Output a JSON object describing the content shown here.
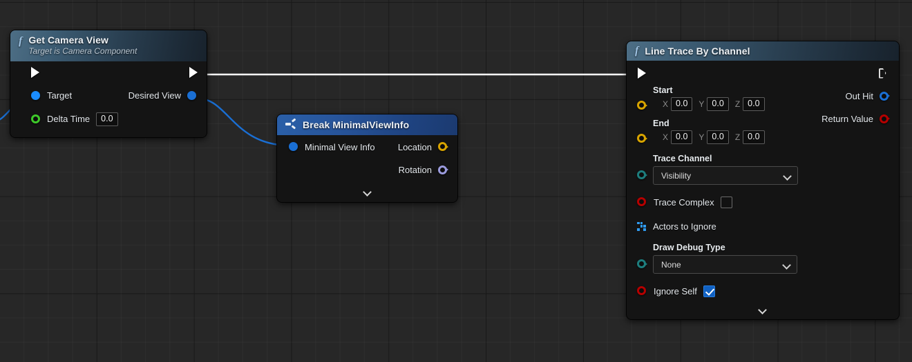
{
  "app": {
    "name": "Unreal Engine Blueprint Graph Editor",
    "canvas_background": "#272727",
    "grid_minor_color": "#333333",
    "grid_major_color": "#121212"
  },
  "wires": [
    {
      "name": "exec-wire-get-camera-view-to-line-trace",
      "type": "exec",
      "color": "#ffffff"
    },
    {
      "name": "data-wire-desired-view-to-minimal-view-info",
      "type": "struct",
      "color": "#1a6fd4"
    },
    {
      "name": "data-wire-incoming-target",
      "type": "object",
      "color": "#1a6fd4"
    }
  ],
  "nodes": {
    "get_camera_view": {
      "title": "Get Camera View",
      "subtitle": "Target is Camera Component",
      "icon": "function-f-icon",
      "header_color": "#3c5c73",
      "exec_in": "exec-in",
      "exec_out": "exec-out",
      "inputs": [
        {
          "label": "Target",
          "pin": "object-pin",
          "color": "#1a8cff",
          "style": "filled"
        },
        {
          "label": "Delta Time",
          "pin": "float-pin",
          "color": "#3ec92a",
          "style": "hollow",
          "value": "0.0"
        }
      ],
      "outputs": [
        {
          "label": "Desired View",
          "pin": "struct-pin",
          "color": "#1a6fd4",
          "style": "filled"
        }
      ]
    },
    "break_minimal_view_info": {
      "title": "Break MinimalViewInfo",
      "icon": "break-struct-icon",
      "header_color": "#27549a",
      "inputs": [
        {
          "label": "Minimal View Info",
          "pin": "struct-pin",
          "color": "#1a6fd4",
          "style": "filled"
        }
      ],
      "outputs": [
        {
          "label": "Location",
          "pin": "vector-pin",
          "color": "#d8a400",
          "style": "hollow"
        },
        {
          "label": "Rotation",
          "pin": "rotator-pin",
          "color": "#9b9bdd",
          "style": "hollow"
        }
      ],
      "expander": "chevron-down-icon"
    },
    "line_trace_by_channel": {
      "title": "Line Trace By Channel",
      "icon": "function-f-icon",
      "header_color": "#3c5c73",
      "exec_in": "exec-in",
      "exec_out": "exec-out",
      "vector_inputs": [
        {
          "label": "Start",
          "pin": "vector-pin",
          "color": "#d8a400",
          "axes": [
            {
              "axis": "X",
              "value": "0.0"
            },
            {
              "axis": "Y",
              "value": "0.0"
            },
            {
              "axis": "Z",
              "value": "0.0"
            }
          ]
        },
        {
          "label": "End",
          "pin": "vector-pin",
          "color": "#d8a400",
          "axes": [
            {
              "axis": "X",
              "value": "0.0"
            },
            {
              "axis": "Y",
              "value": "0.0"
            },
            {
              "axis": "Z",
              "value": "0.0"
            }
          ]
        }
      ],
      "trace_channel": {
        "label": "Trace Channel",
        "pin": "enum-pin",
        "color": "#1d7d7d",
        "value": "Visibility",
        "chevron": "chevron-down-icon"
      },
      "trace_complex": {
        "label": "Trace Complex",
        "pin": "bool-pin",
        "color": "#b50000",
        "checked": false
      },
      "actors_to_ignore": {
        "label": "Actors to Ignore",
        "pin": "array-pin",
        "color": "#2f9bf0"
      },
      "draw_debug_type": {
        "label": "Draw Debug Type",
        "pin": "enum-pin",
        "color": "#1d7d7d",
        "value": "None",
        "chevron": "chevron-down-icon"
      },
      "ignore_self": {
        "label": "Ignore Self",
        "pin": "bool-pin",
        "color": "#b50000",
        "checked": true
      },
      "outputs": [
        {
          "label": "Out Hit",
          "pin": "struct-pin",
          "color": "#1a6fd4",
          "style": "hollow"
        },
        {
          "label": "Return Value",
          "pin": "bool-pin",
          "color": "#b50000",
          "style": "hollow"
        }
      ],
      "expander": "chevron-down-icon"
    }
  }
}
